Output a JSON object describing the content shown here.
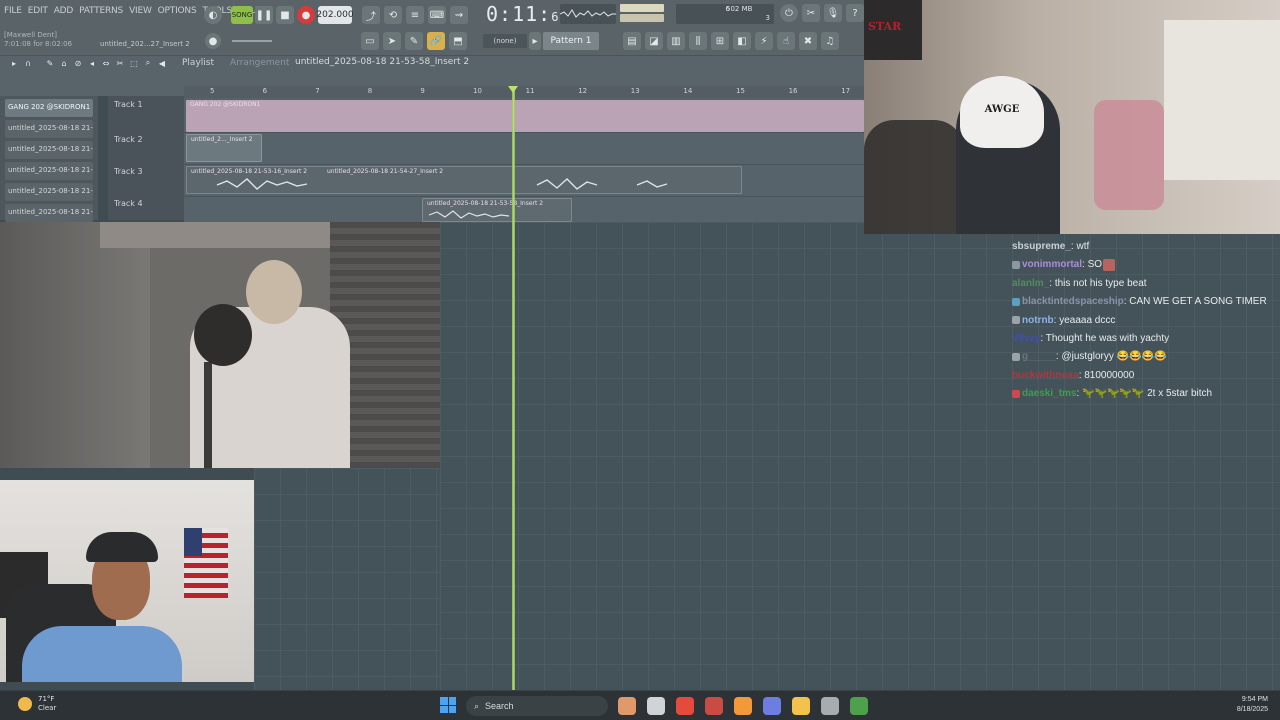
{
  "fl": {
    "menu": [
      "FILE",
      "EDIT",
      "ADD",
      "PATTERNS",
      "VIEW",
      "OPTIONS",
      "TOOLS",
      "HELP"
    ],
    "project_hint_line1": "[Maxwell Dent]",
    "project_hint_line2": "7:01:08 for 8:02:06",
    "title_small": "untitled_202...27_Insert 2",
    "song_label": "SONG",
    "tempo": "202.000",
    "time_main": "0:11",
    "time_frac": "64",
    "cpu_mem": "502 MB",
    "cpu_a": "6",
    "cpu_b": "3",
    "none_label": "(none)",
    "pattern_label": "Pattern 1",
    "playlist_label": "Playlist",
    "playlist_sub": "Arrangement",
    "playlist_title": "untitled_2025-08-18 21-53-58_Insert 2",
    "ruler": [
      "5",
      "6",
      "7",
      "8",
      "9",
      "10",
      "11",
      "12",
      "13",
      "14",
      "15",
      "16",
      "17"
    ],
    "browser_items": [
      "GANG 202 @SKIDRON1",
      "untitled_2025-08-18 21-",
      "untitled_2025-08-18 21-",
      "untitled_2025-08-18 21-",
      "untitled_2025-08-18 21-",
      "untitled_2025-08-18 21-"
    ],
    "tracks": [
      "Track 1",
      "Track 2",
      "Track 3",
      "Track 4"
    ],
    "clips": {
      "c1": "GANG 202 @SKIDRON1",
      "c2": "untitled_2..._Insert 2",
      "c3a": "untitled_2025-08-18 21-53-16_Insert 2",
      "c3b": "untitled_2025-08-18 21-54-27_Insert 2",
      "c4": "untitled_2025-08-18 21-53-58_Insert 2"
    }
  },
  "overlay": {
    "poster_text": "STAR",
    "helmet_text": "AWGE"
  },
  "chat": [
    {
      "user": "sbsupreme_",
      "color": "#c9cfd2",
      "sep": ": ",
      "text": "wtf",
      "badge": null
    },
    {
      "user": "vonimmortal",
      "color": "#a98fd6",
      "sep": ": ",
      "text": "SO",
      "badge": "#8d97a0",
      "emote": "#b7645e"
    },
    {
      "user": "alanlm_",
      "color": "#4f8f59",
      "sep": ": ",
      "text": "this not his type beat",
      "badge": null
    },
    {
      "user": "blacktintedspaceship",
      "color": "#8a93a8",
      "sep": ": ",
      "text": "CAN WE GET A SONG TIMER",
      "badge": "#5c9fc0"
    },
    {
      "user": "notrnb",
      "color": "#8fb2e6",
      "sep": ": ",
      "text": "yeaaaa dccc",
      "badge": "#9aa3a8"
    },
    {
      "user": "V8vzy",
      "color": "#3f4fb0",
      "sep": ": ",
      "text": "Thought he was with yachty",
      "badge": null
    },
    {
      "user": "g_____",
      "color": "#6b757a",
      "sep": ": ",
      "text": "@justgloryy 😂😂😂😂",
      "badge": "#9aa3a8"
    },
    {
      "user": "buckwithnoaa",
      "color": "#b5353a",
      "sep": ": ",
      "text": "810000000",
      "badge": null
    },
    {
      "user": "daeski_tms",
      "color": "#3aa04a",
      "sep": ": ",
      "text": "🦖🦖🦖🦖🦖 2t x 5star bitch",
      "badge": "#d0484c"
    }
  ],
  "taskbar": {
    "temp": "71°F",
    "cond": "Clear",
    "search": "Search",
    "time": "9:54 PM",
    "date": "8/18/2025",
    "apps": [
      {
        "name": "copilot-icon",
        "color": "#e09a6a"
      },
      {
        "name": "file-explorer-icon",
        "color": "#d0d4d6"
      },
      {
        "name": "chrome-icon",
        "color": "#e44b3c"
      },
      {
        "name": "chrome-canary-icon",
        "color": "#ca4a44"
      },
      {
        "name": "fl-studio-icon",
        "color": "#f29a3a"
      },
      {
        "name": "discord-icon",
        "color": "#6e7ee0"
      },
      {
        "name": "folder-icon",
        "color": "#f2c24c"
      },
      {
        "name": "app-grid-icon",
        "color": "#a6acb0"
      },
      {
        "name": "chrome-alt-icon",
        "color": "#4ea04a"
      }
    ]
  }
}
